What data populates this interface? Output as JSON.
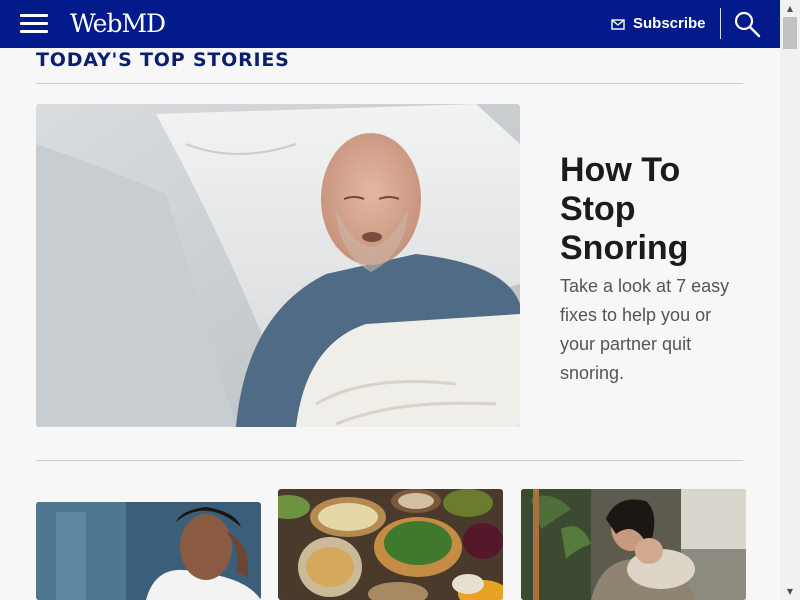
{
  "header": {
    "logo": "WebMD",
    "subscribe_label": "Subscribe",
    "icons": {
      "menu": "hamburger-menu-icon",
      "mail": "mail-icon",
      "search": "search-icon"
    }
  },
  "section": {
    "title": "TODAY'S TOP STORIES"
  },
  "hero": {
    "title": "How To Stop Snoring",
    "description": "Take a look at 7 easy fixes to help you or your partner quit snoring.",
    "image": "man-sleeping-in-bed-photo"
  },
  "cards": [
    {
      "image": "woman-with-headache-photo"
    },
    {
      "image": "healthy-foods-table-photo"
    },
    {
      "image": "mother-holding-baby-photo"
    }
  ],
  "colors": {
    "header_bg": "#031a8a",
    "section_title": "#0a1f72",
    "page_bg": "#f7f7f8"
  }
}
